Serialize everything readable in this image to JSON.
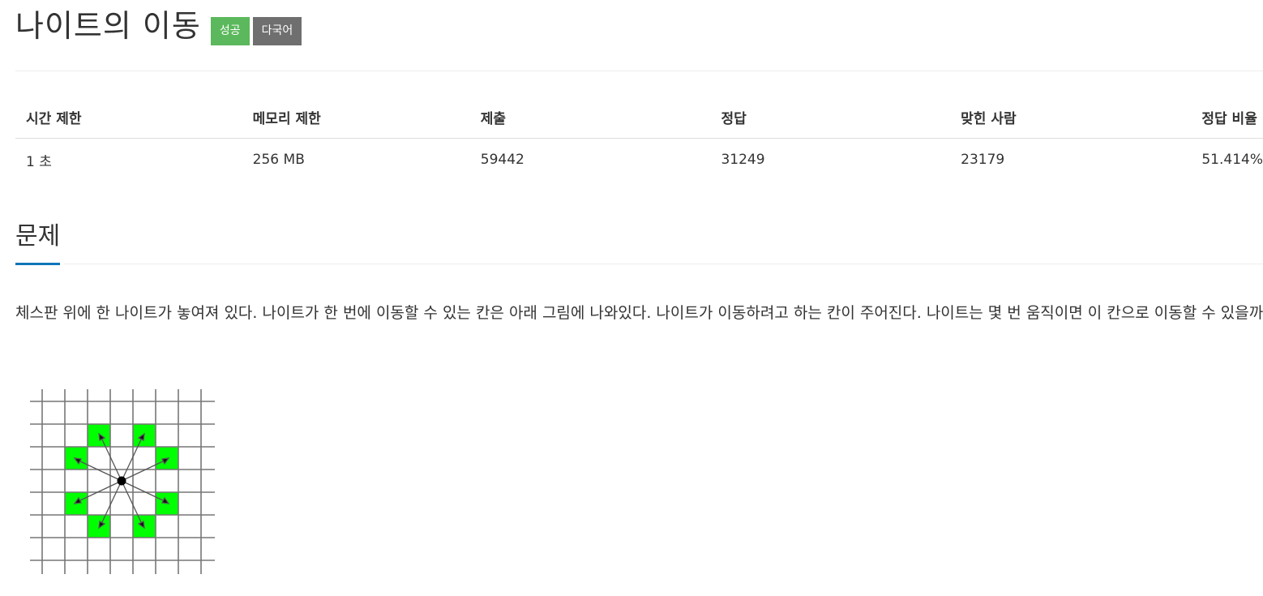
{
  "problem": {
    "title": "나이트의 이동",
    "badges": {
      "success": "성공",
      "language": "다국어"
    }
  },
  "info_table": {
    "headers": [
      "시간 제한",
      "메모리 제한",
      "제출",
      "정답",
      "맞힌 사람",
      "정답 비율"
    ],
    "values": [
      "1 초",
      "256 MB",
      "59442",
      "31249",
      "23179",
      "51.414%"
    ]
  },
  "section": {
    "title": "문제",
    "text": "체스판 위에 한 나이트가 놓여져 있다. 나이트가 한 번에 이동할 수 있는 칸은 아래 그림에 나와있다. 나이트가 이동하려고 하는 칸이 주어진다. 나이트는 몇 번 움직이면 이 칸으로 이동할 수 있을까?"
  },
  "colors": {
    "success": "#5cb85c",
    "language": "#6f6f6f",
    "accent": "#0e76b8",
    "knight_target": "#00ff00"
  }
}
